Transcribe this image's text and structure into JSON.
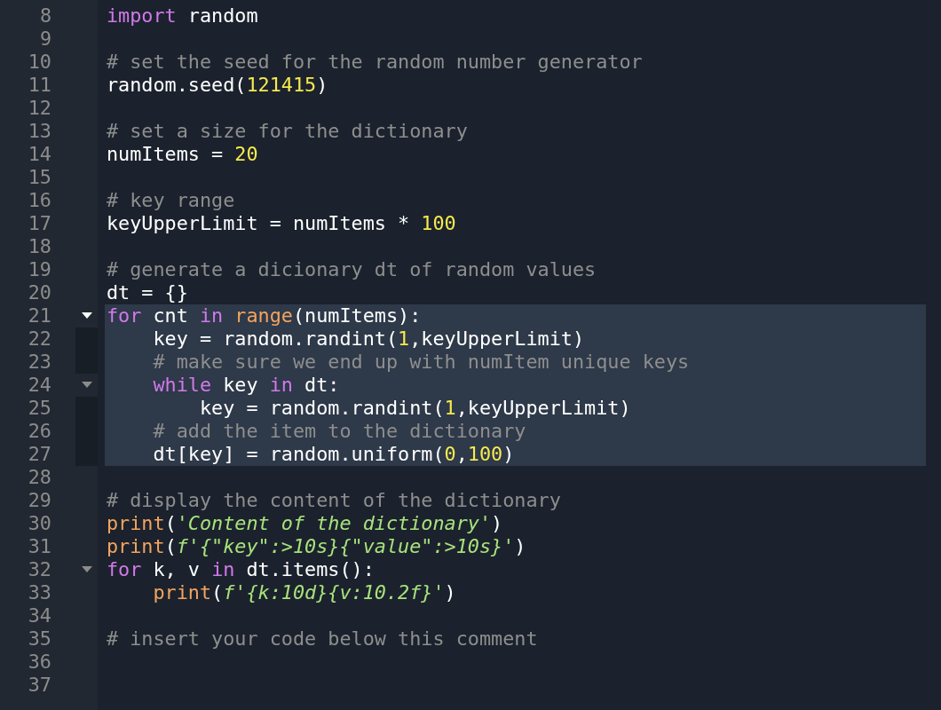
{
  "editor": {
    "lines": [
      {
        "number": "8",
        "tokens": [
          {
            "kind": "keyword",
            "text": "import"
          },
          {
            "kind": "plain",
            "text": " random"
          }
        ]
      },
      {
        "number": "9"
      },
      {
        "number": "10",
        "tokens": [
          {
            "kind": "comment",
            "text": "# set the seed for the random number generator"
          }
        ]
      },
      {
        "number": "11",
        "tokens": [
          {
            "kind": "plain",
            "text": "random.seed("
          },
          {
            "kind": "number",
            "text": "121415"
          },
          {
            "kind": "plain",
            "text": ")"
          }
        ]
      },
      {
        "number": "12"
      },
      {
        "number": "13",
        "tokens": [
          {
            "kind": "comment",
            "text": "# set a size for the dictionary"
          }
        ]
      },
      {
        "number": "14",
        "tokens": [
          {
            "kind": "plain",
            "text": "numItems = "
          },
          {
            "kind": "number",
            "text": "20"
          }
        ]
      },
      {
        "number": "15"
      },
      {
        "number": "16",
        "tokens": [
          {
            "kind": "comment",
            "text": "# key range"
          }
        ]
      },
      {
        "number": "17",
        "tokens": [
          {
            "kind": "plain",
            "text": "keyUpperLimit = numItems * "
          },
          {
            "kind": "number",
            "text": "100"
          }
        ]
      },
      {
        "number": "18"
      },
      {
        "number": "19",
        "tokens": [
          {
            "kind": "comment",
            "text": "# generate a dicionary dt of random values"
          }
        ]
      },
      {
        "number": "20",
        "tokens": [
          {
            "kind": "plain",
            "text": "dt = {}"
          }
        ]
      },
      {
        "number": "21",
        "selected": true,
        "fold": {
          "expanded": true,
          "active": true
        },
        "tokens": [
          {
            "kind": "keyword",
            "text": "for"
          },
          {
            "kind": "plain",
            "text": " cnt "
          },
          {
            "kind": "keyword",
            "text": "in"
          },
          {
            "kind": "builtin",
            "text": " range"
          },
          {
            "kind": "plain",
            "text": "(numItems):"
          }
        ]
      },
      {
        "number": "22",
        "selected": true,
        "tokens": [
          {
            "kind": "plain",
            "text": "    key = random.randint("
          },
          {
            "kind": "number",
            "text": "1"
          },
          {
            "kind": "plain",
            "text": ",keyUpperLimit)"
          }
        ]
      },
      {
        "number": "23",
        "selected": true,
        "tokens": [
          {
            "kind": "comment",
            "text": "    # make sure we end up with numItem unique keys"
          }
        ]
      },
      {
        "number": "24",
        "selected": true,
        "fold": {
          "expanded": true,
          "active": false
        },
        "tokens": [
          {
            "kind": "keyword",
            "text": "    while"
          },
          {
            "kind": "plain",
            "text": " key "
          },
          {
            "kind": "keyword",
            "text": "in"
          },
          {
            "kind": "plain",
            "text": " dt:"
          }
        ]
      },
      {
        "number": "25",
        "selected": true,
        "tokens": [
          {
            "kind": "plain",
            "text": "        key = random.randint("
          },
          {
            "kind": "number",
            "text": "1"
          },
          {
            "kind": "plain",
            "text": ",keyUpperLimit)"
          }
        ]
      },
      {
        "number": "26",
        "selected": true,
        "tokens": [
          {
            "kind": "comment",
            "text": "    # add the item to the dictionary"
          }
        ]
      },
      {
        "number": "27",
        "selected": true,
        "tokens": [
          {
            "kind": "plain",
            "text": "    dt[key] = random.uniform("
          },
          {
            "kind": "number",
            "text": "0"
          },
          {
            "kind": "plain",
            "text": ","
          },
          {
            "kind": "number",
            "text": "100"
          },
          {
            "kind": "plain",
            "text": ")"
          }
        ]
      },
      {
        "number": "28"
      },
      {
        "number": "29",
        "tokens": [
          {
            "kind": "comment",
            "text": "# display the content of the dictionary"
          }
        ]
      },
      {
        "number": "30",
        "tokens": [
          {
            "kind": "builtin",
            "text": "print"
          },
          {
            "kind": "plain",
            "text": "("
          },
          {
            "kind": "string",
            "text": "'Content of the dictionary'"
          },
          {
            "kind": "plain",
            "text": ")"
          }
        ]
      },
      {
        "number": "31",
        "tokens": [
          {
            "kind": "builtin",
            "text": "print"
          },
          {
            "kind": "plain",
            "text": "("
          },
          {
            "kind": "string",
            "text": "f'{\"key\":>10s}{\"value\":>10s}'"
          },
          {
            "kind": "plain",
            "text": ")"
          }
        ]
      },
      {
        "number": "32",
        "fold": {
          "expanded": true,
          "active": false
        },
        "tokens": [
          {
            "kind": "keyword",
            "text": "for"
          },
          {
            "kind": "plain",
            "text": " k, v "
          },
          {
            "kind": "keyword",
            "text": "in"
          },
          {
            "kind": "plain",
            "text": " dt.items():"
          }
        ]
      },
      {
        "number": "33",
        "tokens": [
          {
            "kind": "builtin",
            "text": "    print"
          },
          {
            "kind": "plain",
            "text": "("
          },
          {
            "kind": "string",
            "text": "f'{k:10d}{v:10.2f}'"
          },
          {
            "kind": "plain",
            "text": ")"
          }
        ]
      },
      {
        "number": "34"
      },
      {
        "number": "35",
        "tokens": [
          {
            "kind": "comment",
            "text": "# insert your code below this comment"
          }
        ]
      },
      {
        "number": "36"
      },
      {
        "number": "37"
      }
    ]
  }
}
